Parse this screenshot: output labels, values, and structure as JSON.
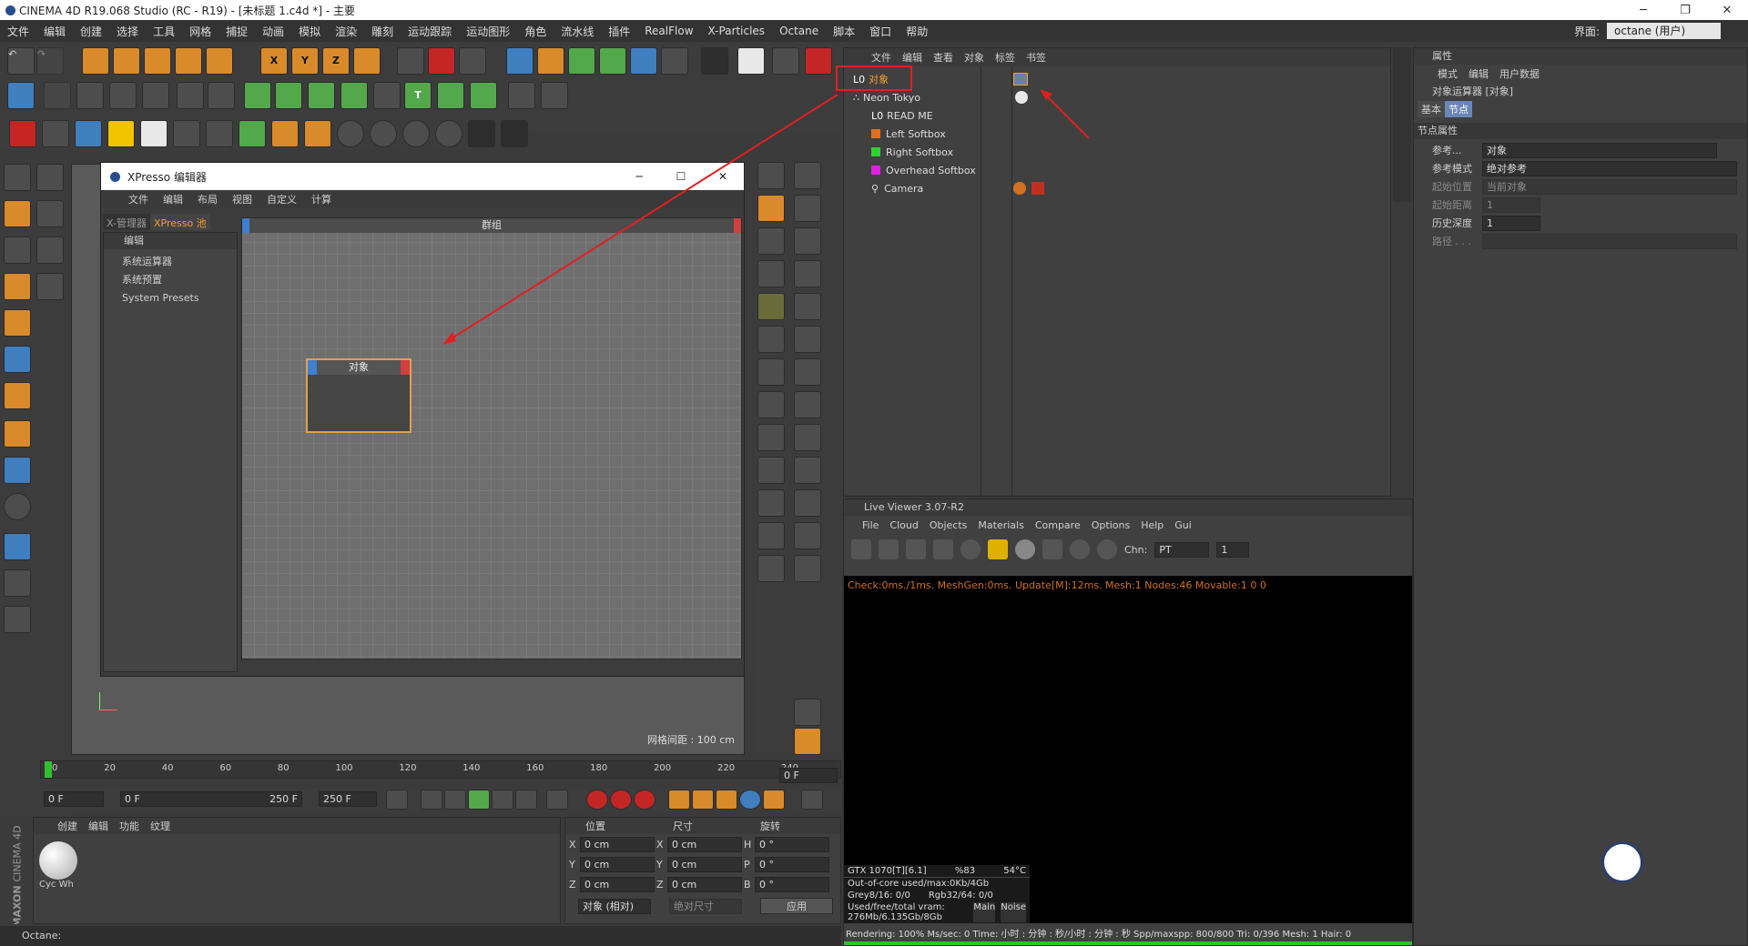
{
  "titlebar": {
    "title": "CINEMA 4D R19.068 Studio (RC - R19) - [未标题 1.c4d *] - 主要",
    "min": "─",
    "restore": "❐",
    "close": "✕"
  },
  "menubar": {
    "items": [
      "文件",
      "编辑",
      "创建",
      "选择",
      "工具",
      "网格",
      "捕捉",
      "动画",
      "模拟",
      "渲染",
      "雕刻",
      "运动跟踪",
      "运动图形",
      "角色",
      "流水线",
      "插件",
      "RealFlow",
      "X-Particles",
      "Octane",
      "脚本",
      "窗口",
      "帮助"
    ],
    "layout_label": "界面:",
    "layout_value": "octane (用户)"
  },
  "toolbar": {
    "x_label": "X",
    "y_label": "Y",
    "z_label": "Z",
    "text_tool": "T"
  },
  "xpresso": {
    "title": "XPresso 编辑器",
    "menu": [
      "文件",
      "编辑",
      "布局",
      "视图",
      "自定义",
      "计算"
    ],
    "tabs": [
      "X-管理器",
      "XPresso 池"
    ],
    "pool_header": "编辑",
    "tree": [
      "系统运算器",
      "系统预置",
      "System Presets"
    ],
    "group_label": "群组",
    "node_title": "对象"
  },
  "viewport": {
    "grid_spacing": "网格间距 : 100 cm"
  },
  "objects": {
    "menu": [
      "文件",
      "编辑",
      "查看",
      "对象",
      "标签",
      "书签"
    ],
    "items": [
      "对象",
      "Neon Tokyo",
      "READ ME",
      "Left Softbox",
      "Right Softbox",
      "Overhead Softbox",
      "Camera"
    ]
  },
  "attributes": {
    "title": "属性",
    "menu": [
      "模式",
      "编辑",
      "用户数据"
    ],
    "object_label": "对象运算器 [对象]",
    "tabs": [
      "基本",
      "节点"
    ],
    "section": "节点属性",
    "rows": [
      {
        "label": "参考...",
        "value": "对象"
      },
      {
        "label": "参考模式",
        "value": "绝对参考"
      },
      {
        "label": "起始位置",
        "value": "当前对象"
      },
      {
        "label": "起始距离",
        "value": "1"
      },
      {
        "label": "历史深度",
        "value": "1"
      },
      {
        "label": "路径 . . .",
        "value": ""
      }
    ]
  },
  "liveviewer": {
    "title": "Live Viewer 3.07-R2",
    "menu": [
      "File",
      "Cloud",
      "Objects",
      "Materials",
      "Compare",
      "Options",
      "Help",
      "Gui"
    ],
    "chn_label": "Chn:",
    "chn_value": "PT",
    "chn_num": "1",
    "status": "Check:0ms./1ms. MeshGen:0ms. Update[M]:12ms. Mesh:1 Nodes:46 Movable:1  0 0",
    "gpu": {
      "name": "GTX 1070[T][6.1]",
      "usage": "%83",
      "temp": "54°C",
      "outofcore": "Out-of-core used/max:0Kb/4Gb",
      "grey": "Grey8/16: 0/0",
      "rgb": "Rgb32/64: 0/0",
      "vram": "Used/free/total vram: 276Mb/6.135Gb/8Gb",
      "tab_main": "Main",
      "tab_noise": "Noise"
    },
    "render": "Rendering: 100%   Ms/sec: 0   Time: 小时 : 分钟 : 秒/小时 : 分钟 : 秒   Spp/maxspp: 800/800      Tri: 0/396   Mesh: 1      Hair: 0"
  },
  "timeline": {
    "ticks": [
      "0",
      "20",
      "40",
      "60",
      "80",
      "100",
      "120",
      "140",
      "160",
      "180",
      "200",
      "220",
      "240"
    ],
    "frame_field": "0 F",
    "start": "0 F",
    "range_start": "0 F",
    "range_end": "250 F",
    "end": "250 F"
  },
  "materials": {
    "menu": [
      "创建",
      "编辑",
      "功能",
      "纹理"
    ],
    "swatch": "Cyc Wh"
  },
  "coords": {
    "headers": [
      "位置",
      "尺寸",
      "旋转"
    ],
    "rows": [
      {
        "axis": "X",
        "pos": "0 cm",
        "size_axis": "X",
        "size": "0 cm",
        "rot_axis": "H",
        "rot": "0 °"
      },
      {
        "axis": "Y",
        "pos": "0 cm",
        "size_axis": "Y",
        "size": "0 cm",
        "rot_axis": "P",
        "rot": "0 °"
      },
      {
        "axis": "Z",
        "pos": "0 cm",
        "size_axis": "Z",
        "size": "0 cm",
        "rot_axis": "B",
        "rot": "0 °"
      }
    ],
    "mode": "对象 (相对)",
    "size_mode": "绝对尺寸",
    "apply": "应用"
  },
  "statusbar": {
    "text": "Octane:"
  },
  "brand": {
    "maxon": "MAXON",
    "c4d": "CINEMA 4D"
  },
  "colors": {
    "accent": "#e0a050",
    "red": "#e02020",
    "bg": "#3b3b3b"
  }
}
